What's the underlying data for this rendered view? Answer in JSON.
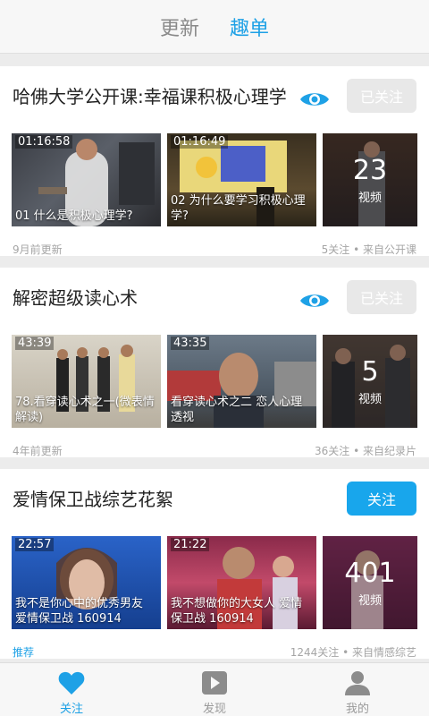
{
  "top_tabs": [
    {
      "label": "更新",
      "active": false
    },
    {
      "label": "趣单",
      "active": true
    }
  ],
  "cards": [
    {
      "title": "哈佛大学公开课:幸福课积极心理学",
      "follow_label": "已关注",
      "followed": true,
      "videos": [
        {
          "duration": "01:16:58",
          "title": "01 什么是积极心理学?"
        },
        {
          "duration": "01:16:49",
          "title": "02 为什么要学习积极心理学?"
        }
      ],
      "video_count": "23",
      "video_count_label": "视频",
      "meta_left": "9月前更新",
      "meta_right": "5关注 • 来自公开课"
    },
    {
      "title": "解密超级读心术",
      "follow_label": "已关注",
      "followed": true,
      "videos": [
        {
          "duration": "43:39",
          "title": "78.看穿读心术之一(微表情解读)"
        },
        {
          "duration": "43:35",
          "title": "看穿读心术之二 恋人心理透视"
        }
      ],
      "video_count": "5",
      "video_count_label": "视频",
      "meta_left": "4年前更新",
      "meta_right": "36关注 • 来自纪录片"
    },
    {
      "title": "爱情保卫战综艺花絮",
      "follow_label": "关注",
      "followed": false,
      "videos": [
        {
          "duration": "22:57",
          "title": "我不是你心中的优秀男友 爱情保卫战 160914"
        },
        {
          "duration": "21:22",
          "title": "我不想做你的大女人 爱情保卫战 160914"
        }
      ],
      "video_count": "401",
      "video_count_label": "视频",
      "meta_left": "推荐",
      "meta_right": "1244关注 • 来自情感综艺"
    }
  ],
  "bottom_nav": [
    {
      "label": "关注",
      "icon": "heart-icon",
      "active": true
    },
    {
      "label": "发现",
      "icon": "play-icon",
      "active": false
    },
    {
      "label": "我的",
      "icon": "person-icon",
      "active": false
    }
  ],
  "colors": {
    "accent": "#1ea1e6",
    "follow_blue": "#18a6ec",
    "followed_gray": "#e8e8e8"
  }
}
